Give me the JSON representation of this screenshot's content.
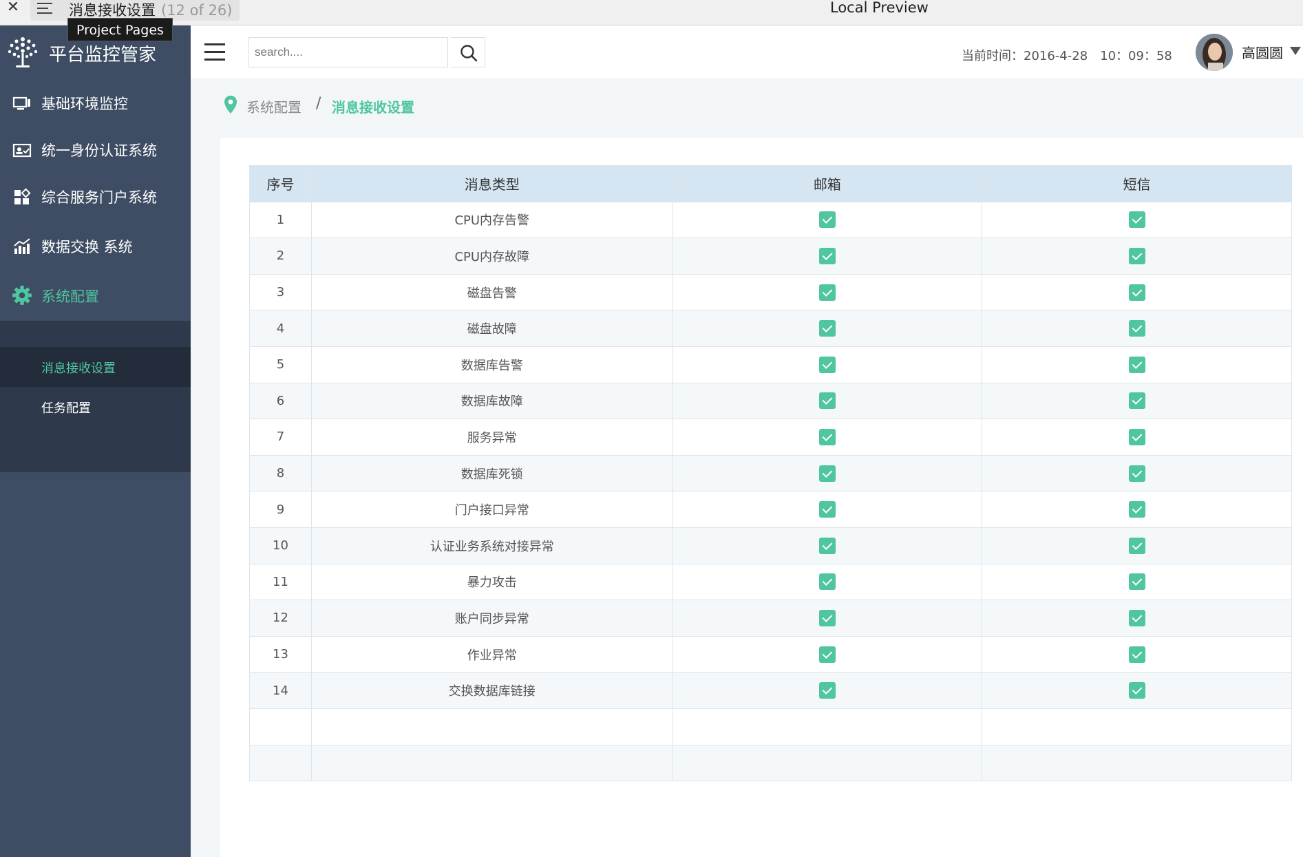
{
  "preview_bar": {
    "page_title": "消息接收设置",
    "page_count": "(12 of 26)",
    "center_title": "Local Preview",
    "tooltip": "Project Pages"
  },
  "app": {
    "name": "平台监控管家"
  },
  "sidebar": {
    "items": [
      {
        "label": "基础环境监控",
        "icon": "monitor-icon"
      },
      {
        "label": "统一身份认证系统",
        "icon": "id-card-icon"
      },
      {
        "label": "综合服务门户系统",
        "icon": "grid-apps-icon"
      },
      {
        "label": "数据交换 系统",
        "icon": "chart-icon"
      },
      {
        "label": "系统配置",
        "icon": "gear-icon",
        "active": true
      }
    ],
    "submenu": [
      {
        "label": "消息接收设置",
        "active": true
      },
      {
        "label": "任务配置"
      }
    ]
  },
  "header": {
    "search_placeholder": "search....",
    "time_text": "当前时间：2016-4-28　10：09：58",
    "username": "高圆圆"
  },
  "breadcrumb": {
    "parent": "系统配置",
    "separator": "/",
    "current": "消息接收设置"
  },
  "table": {
    "headers": [
      "序号",
      "消息类型",
      "邮箱",
      "短信"
    ],
    "rows": [
      {
        "no": "1",
        "type": "CPU内存告警",
        "email": true,
        "sms": true
      },
      {
        "no": "2",
        "type": "CPU内存故障",
        "email": true,
        "sms": true
      },
      {
        "no": "3",
        "type": "磁盘告警",
        "email": true,
        "sms": true
      },
      {
        "no": "4",
        "type": "磁盘故障",
        "email": true,
        "sms": true
      },
      {
        "no": "5",
        "type": "数据库告警",
        "email": true,
        "sms": true
      },
      {
        "no": "6",
        "type": "数据库故障",
        "email": true,
        "sms": true
      },
      {
        "no": "7",
        "type": "服务异常",
        "email": true,
        "sms": true
      },
      {
        "no": "8",
        "type": "数据库死锁",
        "email": true,
        "sms": true
      },
      {
        "no": "9",
        "type": "门户接口异常",
        "email": true,
        "sms": true
      },
      {
        "no": "10",
        "type": "认证业务系统对接异常",
        "email": true,
        "sms": true
      },
      {
        "no": "11",
        "type": "暴力攻击",
        "email": true,
        "sms": true
      },
      {
        "no": "12",
        "type": "账户同步异常",
        "email": true,
        "sms": true
      },
      {
        "no": "13",
        "type": "作业异常",
        "email": true,
        "sms": true
      },
      {
        "no": "14",
        "type": "交换数据库链接",
        "email": true,
        "sms": true
      }
    ],
    "empty_rows": 2
  },
  "colors": {
    "accent": "#4fc6a0",
    "sidebar_bg": "#3e4d63",
    "submenu_bg": "#2e3a4c",
    "table_header_bg": "#d5e5f1"
  }
}
